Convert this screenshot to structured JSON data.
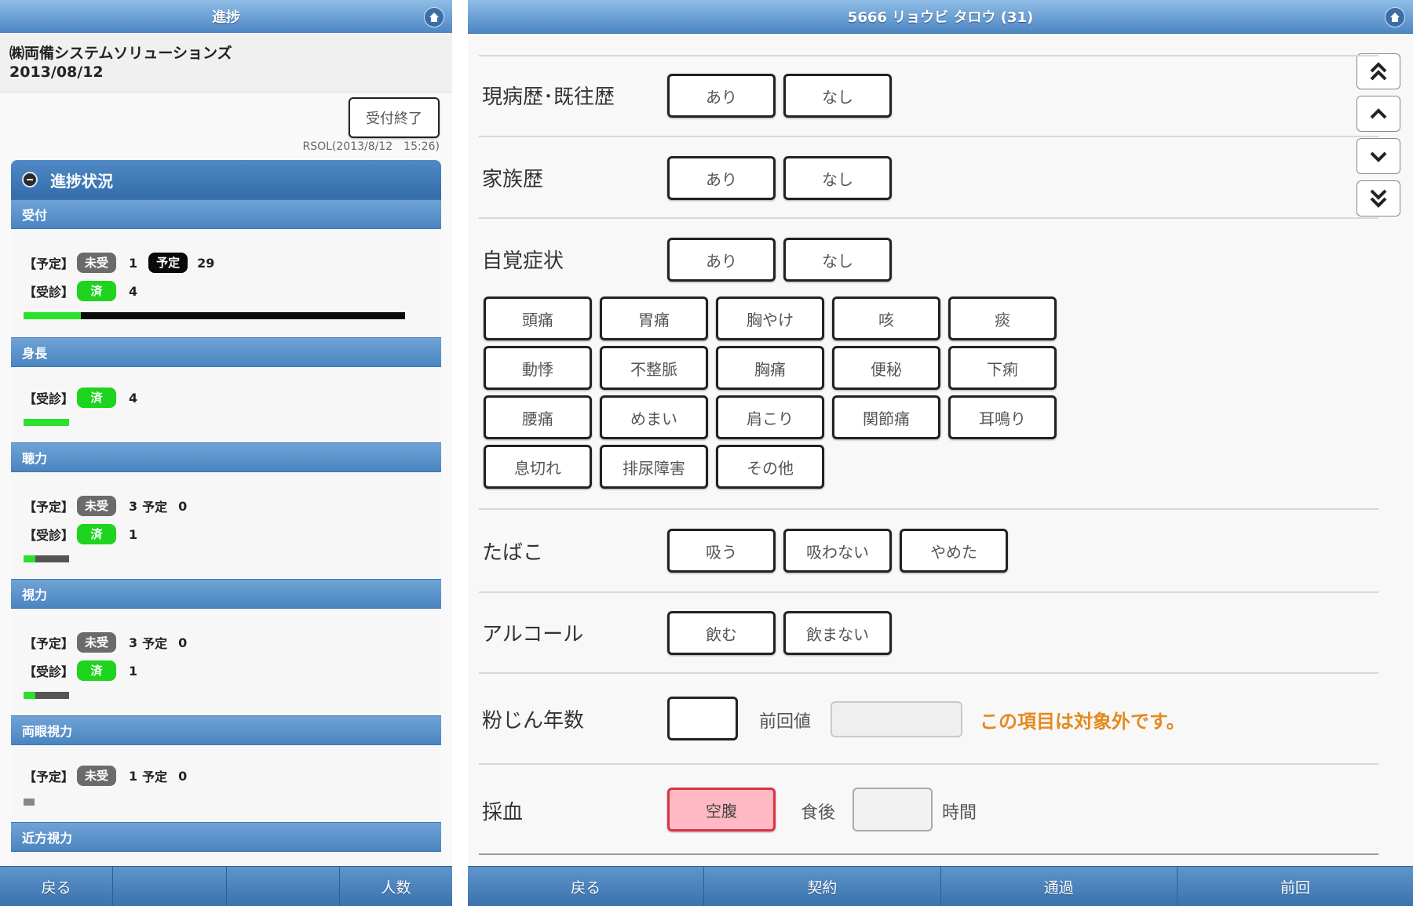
{
  "left": {
    "title": "進捗",
    "company": "㈱両備システムソリューションズ",
    "date": "2013/08/12",
    "close_button": "受付終了",
    "timestamp": "RSOL(2013/8/12　15:26)",
    "progress_header": "進捗状況",
    "sections": [
      {
        "title": "受付",
        "rows": [
          {
            "tag": "【予定】",
            "pill": "未受",
            "count": "1",
            "extra_pill": "予定",
            "extra": "29"
          },
          {
            "tag": "【受診】",
            "pill": "済",
            "count": "4"
          }
        ],
        "progress": 0.15
      },
      {
        "title": "身長",
        "rows": [
          {
            "tag": "【受診】",
            "pill": "済",
            "count": "4"
          }
        ],
        "progress": 1.0
      },
      {
        "title": "聴力",
        "rows": [
          {
            "tag": "【予定】",
            "pill": "未受",
            "count": "3",
            "extra_label": "予定",
            "extra": "0"
          },
          {
            "tag": "【受診】",
            "pill": "済",
            "count": "1"
          }
        ],
        "progress": 0.25
      },
      {
        "title": "視力",
        "rows": [
          {
            "tag": "【予定】",
            "pill": "未受",
            "count": "3",
            "extra_label": "予定",
            "extra": "0"
          },
          {
            "tag": "【受診】",
            "pill": "済",
            "count": "1"
          }
        ],
        "progress": 0.25
      },
      {
        "title": "両眼視力",
        "rows": [
          {
            "tag": "【予定】",
            "pill": "未受",
            "count": "1",
            "extra_label": "予定",
            "extra": "0"
          }
        ],
        "progress": 0.0
      },
      {
        "title": "近方視力",
        "rows": []
      }
    ],
    "bottom": [
      "戻る",
      "",
      "",
      "人数"
    ]
  },
  "right": {
    "title": "5666 リョウビ タロウ (31)",
    "history_label": "現病歴･既往歴",
    "family_label": "家族歴",
    "symptom_label": "自覚症状",
    "yes": "あり",
    "no": "なし",
    "symptoms": [
      "頭痛",
      "胃痛",
      "胸やけ",
      "咳",
      "痰",
      "動悸",
      "不整脈",
      "胸痛",
      "便秘",
      "下痢",
      "腰痛",
      "めまい",
      "肩こり",
      "関節痛",
      "耳鳴り",
      "息切れ",
      "排尿障害",
      "その他"
    ],
    "tobacco_label": "たばこ",
    "tobacco_options": [
      "吸う",
      "吸わない",
      "やめた"
    ],
    "alcohol_label": "アルコール",
    "alcohol_options": [
      "飲む",
      "飲まない"
    ],
    "dust_label": "粉じん年数",
    "previous_label": "前回値",
    "not_applicable": "この項目は対象外です。",
    "blood_label": "採血",
    "fasting": "空腹",
    "after_meal": "食後",
    "hours": "時間",
    "bottom": [
      "戻る",
      "契約",
      "通過",
      "前回"
    ],
    "accent_pink": "#ffb9c4",
    "accent_orange": "#e48a20"
  }
}
